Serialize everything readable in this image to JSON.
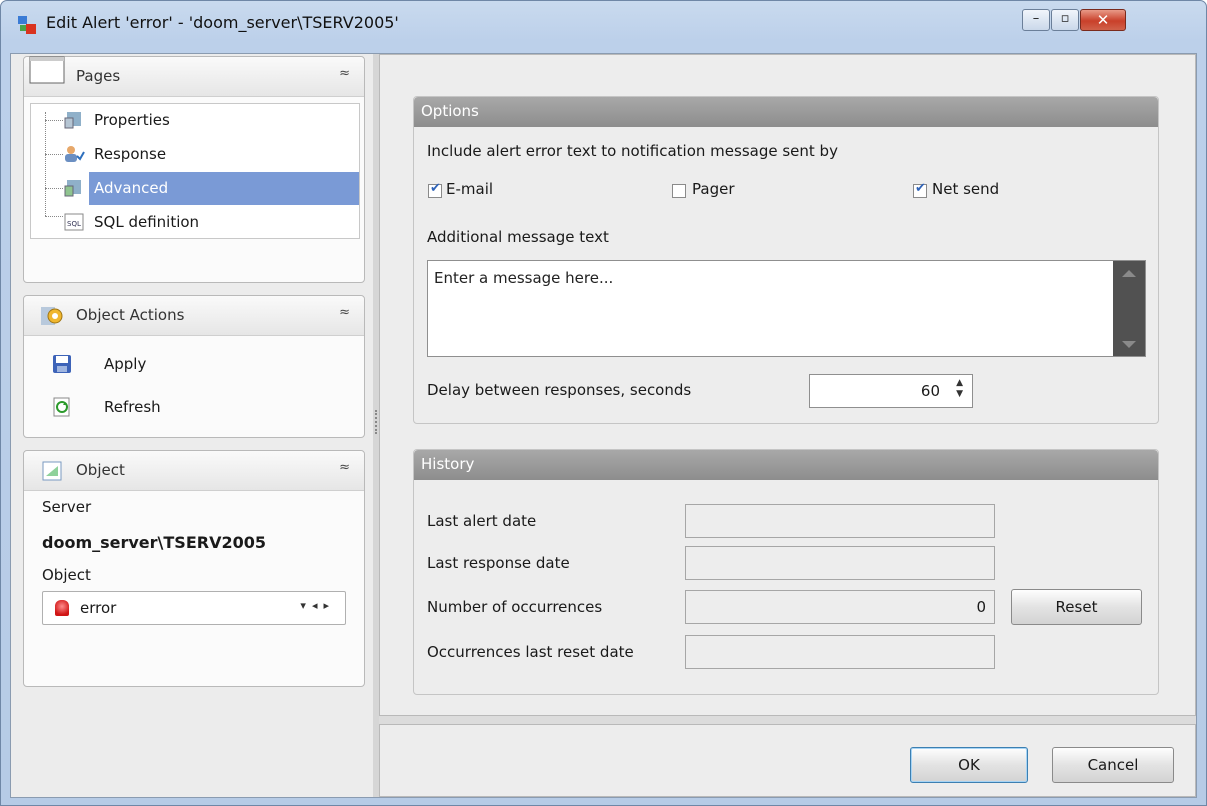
{
  "window": {
    "title": "Edit Alert 'error' - 'doom_server\\TSERV2005'",
    "controls": {
      "minimize": "–",
      "maximize": "▫",
      "close": "✕"
    }
  },
  "sidebar": {
    "pages": {
      "title": "Pages",
      "items": [
        {
          "label": "Properties",
          "icon": "properties-icon"
        },
        {
          "label": "Response",
          "icon": "response-icon"
        },
        {
          "label": "Advanced",
          "icon": "advanced-icon",
          "selected": true
        },
        {
          "label": "SQL definition",
          "icon": "sql-icon"
        }
      ]
    },
    "actions": {
      "title": "Object Actions",
      "items": [
        {
          "label": "Apply",
          "icon": "save-icon"
        },
        {
          "label": "Refresh",
          "icon": "refresh-icon"
        }
      ]
    },
    "object": {
      "title": "Object",
      "server_label": "Server",
      "server_value": "doom_server\\TSERV2005",
      "object_label": "Object",
      "object_value": "error"
    },
    "collapse_glyph": "≈"
  },
  "options": {
    "title": "Options",
    "include_label": "Include alert error text to notification message sent by",
    "email": {
      "label": "E-mail",
      "checked": true
    },
    "pager": {
      "label": "Pager",
      "checked": false
    },
    "netsend": {
      "label": "Net send",
      "checked": true
    },
    "additional_label": "Additional message text",
    "message_placeholder": "Enter a message here...",
    "delay_label": "Delay between responses, seconds",
    "delay_value": "60"
  },
  "history": {
    "title": "History",
    "last_alert_label": "Last alert date",
    "last_alert_value": "",
    "last_response_label": "Last response date",
    "last_response_value": "",
    "occurrences_label": "Number of occurrences",
    "occurrences_value": "0",
    "reset_label": "Reset",
    "reset_date_label": "Occurrences last reset date",
    "reset_date_value": ""
  },
  "footer": {
    "ok_label": "OK",
    "cancel_label": "Cancel"
  },
  "colors": {
    "selection": "#7a9ad6",
    "group_header": "#8d8d8d",
    "close_button": "#c9402a"
  }
}
